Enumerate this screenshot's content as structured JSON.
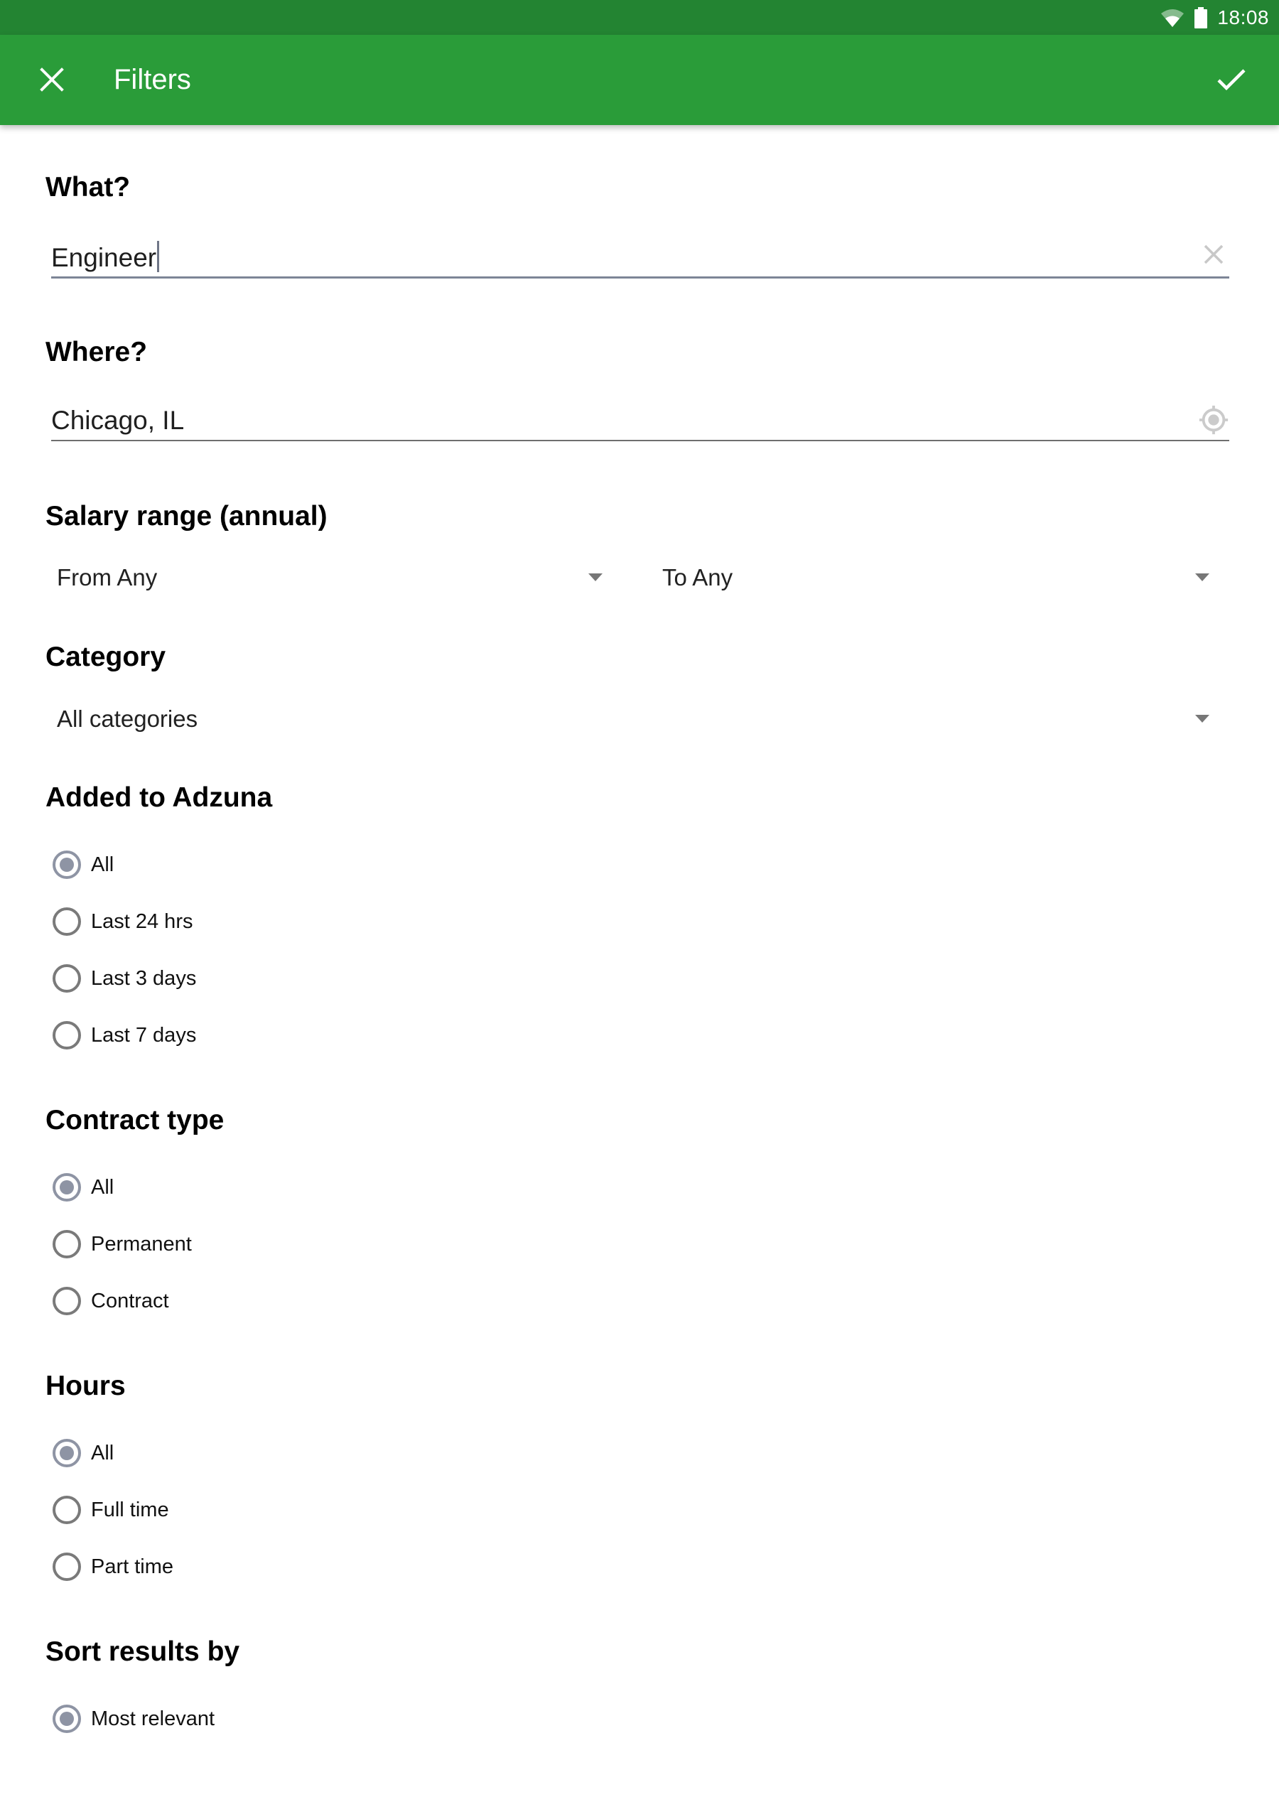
{
  "status_bar": {
    "time": "18:08",
    "icons": [
      "wifi-icon",
      "battery-icon"
    ]
  },
  "app_bar": {
    "title": "Filters",
    "close_icon": "close-icon",
    "confirm_icon": "check-icon",
    "color": "#2a9c39",
    "status_color": "#238432"
  },
  "what": {
    "heading": "What?",
    "value": "Engineer",
    "clear_icon": "clear-icon"
  },
  "where": {
    "heading": "Where?",
    "value": "Chicago, IL",
    "location_icon": "my-location-icon"
  },
  "salary": {
    "heading": "Salary range (annual)",
    "from": "From Any",
    "to": "To Any"
  },
  "category": {
    "heading": "Category",
    "value": "All categories"
  },
  "added": {
    "heading": "Added to Adzuna",
    "options": [
      {
        "label": "All",
        "checked": true
      },
      {
        "label": "Last 24 hrs",
        "checked": false
      },
      {
        "label": "Last 3 days",
        "checked": false
      },
      {
        "label": "Last 7 days",
        "checked": false
      }
    ]
  },
  "contract": {
    "heading": "Contract type",
    "options": [
      {
        "label": "All",
        "checked": true
      },
      {
        "label": "Permanent",
        "checked": false
      },
      {
        "label": "Contract",
        "checked": false
      }
    ]
  },
  "hours": {
    "heading": "Hours",
    "options": [
      {
        "label": "All",
        "checked": true
      },
      {
        "label": "Full time",
        "checked": false
      },
      {
        "label": "Part time",
        "checked": false
      }
    ]
  },
  "sort": {
    "heading": "Sort results by",
    "options": [
      {
        "label": "Most relevant",
        "checked": true
      }
    ]
  }
}
